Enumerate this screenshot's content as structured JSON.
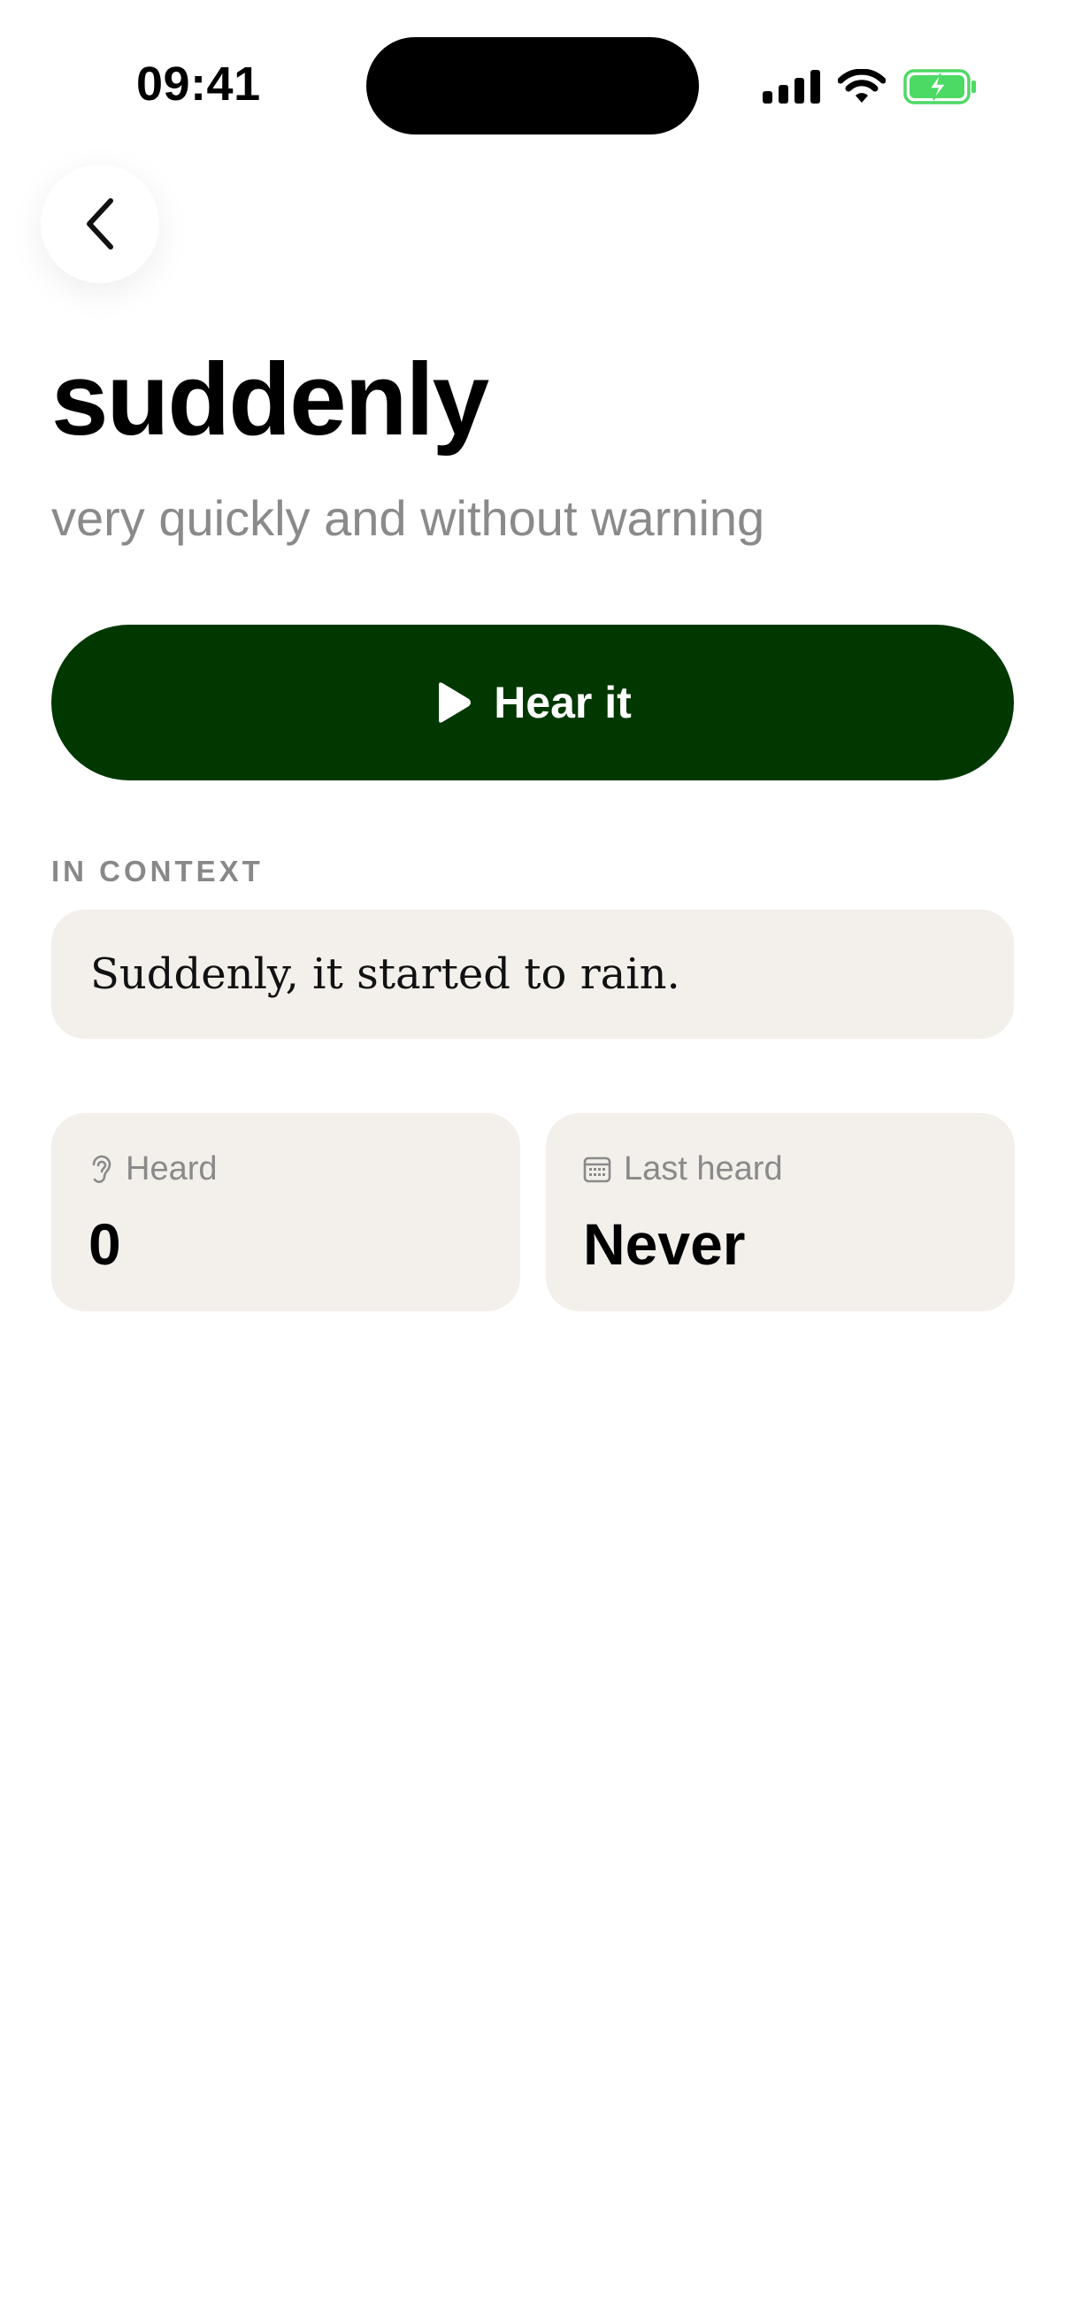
{
  "status_bar": {
    "time": "09:41",
    "icons": [
      "signal-icon",
      "wifi-icon",
      "battery-charging-icon"
    ],
    "battery_color": "#4cd964"
  },
  "nav": {
    "back_icon": "chevron-left-icon"
  },
  "word": {
    "title": "suddenly",
    "definition": "very quickly and without warning"
  },
  "actions": {
    "hear_label": "Hear it",
    "hear_icon": "play-icon",
    "accent_color": "#003800"
  },
  "context": {
    "label": "IN CONTEXT",
    "sentence": "Suddenly, it started to rain."
  },
  "stats": {
    "heard": {
      "label": "Heard",
      "value": "0",
      "icon": "ear-icon"
    },
    "last_heard": {
      "label": "Last heard",
      "value": "Never",
      "icon": "calendar-icon"
    }
  }
}
